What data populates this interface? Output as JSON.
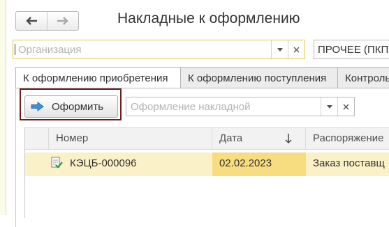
{
  "window": {
    "title": "Накладные к оформлению"
  },
  "navigation": {
    "back_icon": "arrow-left-icon",
    "forward_icon": "arrow-right-icon"
  },
  "filters": {
    "organization": {
      "placeholder": "Организация",
      "value": ""
    },
    "selector": {
      "value": "ПРОЧЕЕ (ПКП"
    }
  },
  "tabs": [
    {
      "label": "К оформлению приобретения",
      "active": true
    },
    {
      "label": "К оформлению поступления",
      "active": false
    },
    {
      "label": "Контроль",
      "active": false
    }
  ],
  "toolbar": {
    "process_label": "Оформить",
    "process_icon": "arrow-right-icon",
    "doc_field": {
      "placeholder": "Оформление накладной",
      "value": ""
    }
  },
  "table": {
    "columns": [
      "Номер",
      "Дата",
      "Распоряжение"
    ],
    "sort_icon": "sort-down-arrow-icon",
    "rows": [
      {
        "number": "КЭЦБ-000096",
        "date": "02.02.2023",
        "order": "Заказ поставщ",
        "icon": "document-check-icon"
      }
    ]
  },
  "colors": {
    "accent_border": "#6e1c1c",
    "active_field_border": "#e7c74b",
    "row_selected": "#fbf1c8",
    "cell_highlight": "#f7dd7f",
    "button_icon": "#3b8fd9"
  }
}
